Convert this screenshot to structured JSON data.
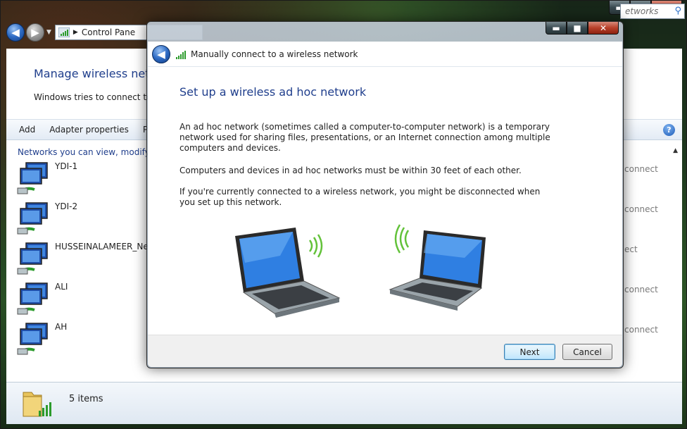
{
  "window": {
    "caption": {
      "minimize": "▬",
      "maximize": "■",
      "close": "✕"
    }
  },
  "explorer": {
    "address_crumb": "Control Pane",
    "search_placeholder": "etworks",
    "page_title": "Manage wireless netw",
    "page_description": "Windows tries to connect to",
    "toolbar": {
      "add": "Add",
      "adapter_properties": "Adapter properties",
      "truncated_item": "Pr"
    },
    "section_header": "Networks you can view, modify,",
    "networks": [
      {
        "name": "YDI-1",
        "action": "connect"
      },
      {
        "name": "YDI-2",
        "action": "connect"
      },
      {
        "name": "HUSSEINALAMEER_Ne",
        "action": "ect"
      },
      {
        "name": "ALI",
        "action": "connect"
      },
      {
        "name": "AH",
        "action": "connect"
      }
    ],
    "status": {
      "item_count": "5 items"
    }
  },
  "dialog": {
    "caption": {
      "minimize": "▬",
      "maximize": "■",
      "close": "✕"
    },
    "header_title": "Manually connect to a wireless network",
    "heading": "Set up a wireless ad hoc network",
    "paragraphs": [
      "An ad hoc network (sometimes called a computer-to-computer network) is a temporary network used for sharing files, presentations, or an Internet connection among multiple computers and devices.",
      "Computers and devices in ad hoc networks must be within 30 feet of each other.",
      "If you're currently connected to a wireless network, you might be disconnected when you set up this network."
    ],
    "buttons": {
      "next": "Next",
      "cancel": "Cancel"
    }
  },
  "colors": {
    "heading_blue": "#1f3e8c",
    "signal_green": "#2c9b2c"
  }
}
